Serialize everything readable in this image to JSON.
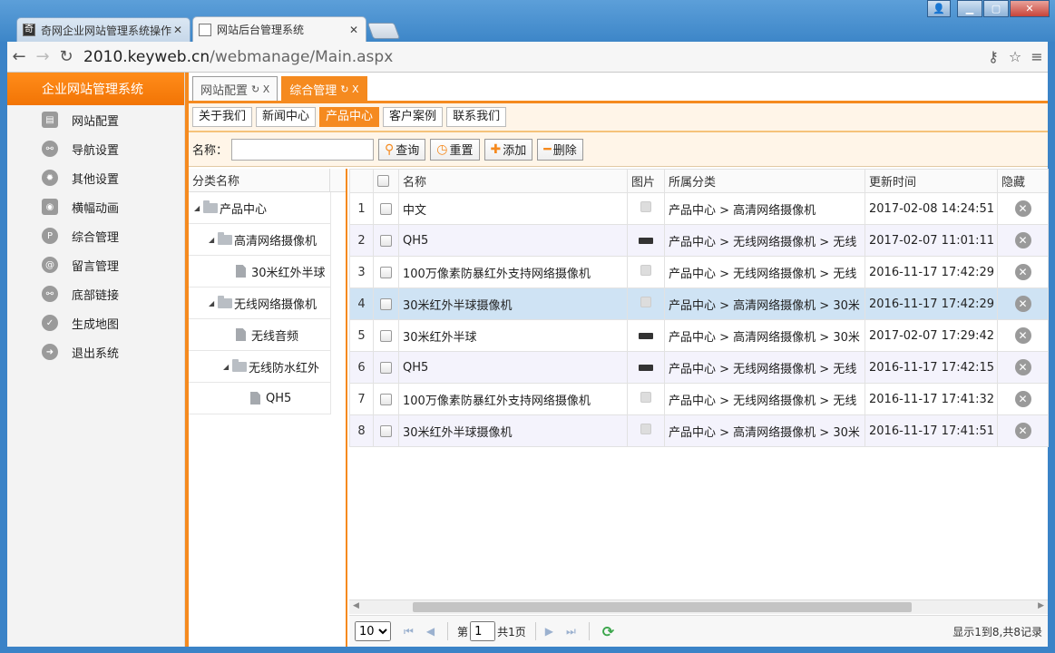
{
  "browser": {
    "tabs": [
      {
        "favicon": "奇",
        "title": "奇网企业网站管理系统操作"
      },
      {
        "favicon": "",
        "title": "网站后台管理系统"
      }
    ],
    "url_host": "2010.keyweb.cn",
    "url_path": "/webmanage/Main.aspx"
  },
  "sidebar": {
    "brand": "企业网站管理系统",
    "items": [
      {
        "label": "网站配置",
        "icon": "config-icon"
      },
      {
        "label": "导航设置",
        "icon": "link-icon"
      },
      {
        "label": "其他设置",
        "icon": "gear-icon"
      },
      {
        "label": "横幅动画",
        "icon": "camera-icon"
      },
      {
        "label": "综合管理",
        "icon": "p-icon"
      },
      {
        "label": "留言管理",
        "icon": "at-icon"
      },
      {
        "label": "底部链接",
        "icon": "link-icon"
      },
      {
        "label": "生成地图",
        "icon": "check-icon"
      },
      {
        "label": "退出系统",
        "icon": "exit-icon"
      }
    ]
  },
  "main_tabs": [
    {
      "label": "网站配置",
      "active": false
    },
    {
      "label": "综合管理",
      "active": true
    }
  ],
  "sub_tabs": [
    {
      "label": "关于我们"
    },
    {
      "label": "新闻中心"
    },
    {
      "label": "产品中心"
    },
    {
      "label": "客户案例"
    },
    {
      "label": "联系我们"
    }
  ],
  "search": {
    "label": "名称：",
    "value": "",
    "buttons": {
      "query": "查询",
      "reset": "重置",
      "add": "添加",
      "delete": "删除"
    }
  },
  "tree": {
    "header": "分类名称",
    "nodes": [
      {
        "label": "产品中心",
        "level": 0,
        "type": "folder"
      },
      {
        "label": "高清网络摄像机",
        "level": 1,
        "type": "folder"
      },
      {
        "label": "30米红外半球",
        "level": 2,
        "type": "file"
      },
      {
        "label": "无线网络摄像机",
        "level": 1,
        "type": "folder"
      },
      {
        "label": "无线音频",
        "level": 2,
        "type": "file"
      },
      {
        "label": "无线防水红外",
        "level": 2,
        "type": "folder"
      },
      {
        "label": "QH5",
        "level": 3,
        "type": "file"
      }
    ]
  },
  "grid": {
    "columns": {
      "name": "名称",
      "image": "图片",
      "category": "所属分类",
      "updated": "更新时间",
      "hidden": "隐藏"
    },
    "rows": [
      {
        "num": "1",
        "name": "中文",
        "thumb": "light",
        "category": "产品中心 > 高清网络摄像机",
        "updated": "2017-02-08 14:24:51"
      },
      {
        "num": "2",
        "name": "QH5",
        "thumb": "dark",
        "category": "产品中心 > 无线网络摄像机 > 无线",
        "updated": "2017-02-07 11:01:11"
      },
      {
        "num": "3",
        "name": "100万像素防暴红外支持网络摄像机",
        "thumb": "light",
        "category": "产品中心 > 无线网络摄像机 > 无线",
        "updated": "2016-11-17 17:42:29"
      },
      {
        "num": "4",
        "name": "30米红外半球摄像机",
        "thumb": "light",
        "category": "产品中心 > 高清网络摄像机 > 30米",
        "updated": "2016-11-17 17:42:29"
      },
      {
        "num": "5",
        "name": "30米红外半球",
        "thumb": "dark",
        "category": "产品中心 > 高清网络摄像机 > 30米",
        "updated": "2017-02-07 17:29:42"
      },
      {
        "num": "6",
        "name": "QH5",
        "thumb": "dark",
        "category": "产品中心 > 无线网络摄像机 > 无线",
        "updated": "2016-11-17 17:42:15"
      },
      {
        "num": "7",
        "name": "100万像素防暴红外支持网络摄像机",
        "thumb": "light",
        "category": "产品中心 > 无线网络摄像机 > 无线",
        "updated": "2016-11-17 17:41:32"
      },
      {
        "num": "8",
        "name": "30米红外半球摄像机",
        "thumb": "light",
        "category": "产品中心 > 高清网络摄像机 > 30米",
        "updated": "2016-11-17 17:41:51"
      }
    ],
    "selected_row": 3
  },
  "pager": {
    "page_size": "10",
    "page_label_before": "第",
    "page_value": "1",
    "page_label_after": "共1页",
    "info": "显示1到8,共8记录"
  },
  "colors": {
    "accent": "#f58a1f"
  }
}
